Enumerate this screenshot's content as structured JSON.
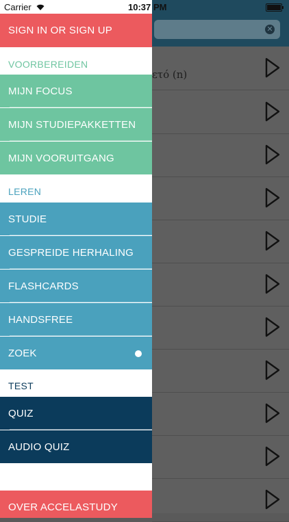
{
  "status_bar": {
    "carrier": "Carrier",
    "time": "10:37",
    "pm_suffix": "PM"
  },
  "main": {
    "first_row_text": "ετό (n)",
    "rows": 11
  },
  "drawer": {
    "sign_in": "SIGN IN OR SIGN UP",
    "section_prepare": "VOORBEREIDEN",
    "prepare_items": [
      "MIJN FOCUS",
      "MIJN STUDIEPAKKETTEN",
      "MIJN VOORUITGANG"
    ],
    "section_learn": "LEREN",
    "learn_items": [
      "STUDIE",
      "GESPREIDE HERHALING",
      "FLASHCARDS",
      "HANDSFREE",
      "ZOEK"
    ],
    "section_test": "TEST",
    "test_items": [
      "QUIZ",
      "AUDIO QUIZ"
    ],
    "about": "OVER ACCELASTUDY"
  },
  "colors": {
    "red": "#ec5a5e",
    "green": "#6ec5a0",
    "blue": "#4aa1bd",
    "navy": "#0b3b5b",
    "header_green_text": "#6ec5a0",
    "header_blue_text": "#4aa1bd",
    "header_navy_text": "#0b3b5b"
  }
}
